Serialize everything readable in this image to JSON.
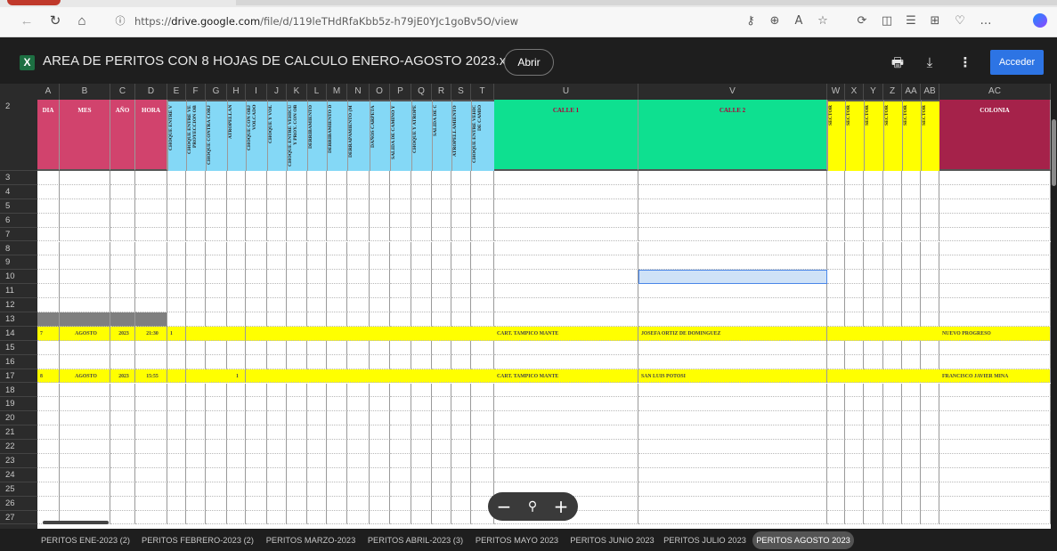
{
  "browser": {
    "url_prefix": "https://",
    "url_domain": "drive.google.com",
    "url_path": "/file/d/119leTHdRfaKbb5z-h79jE0YJc1goBv5O/view"
  },
  "viewer": {
    "file_icon": "X",
    "title": "AREA DE PERITOS CON 8 HOJAS DE CALCULO ENERO-AGOSTO 2023.xlsx",
    "open_label": "Abrir",
    "login_label": "Acceder"
  },
  "spreadsheet": {
    "columns": [
      "A",
      "B",
      "C",
      "D",
      "E",
      "F",
      "G",
      "H",
      "I",
      "J",
      "K",
      "L",
      "M",
      "N",
      "O",
      "P",
      "Q",
      "R",
      "S",
      "T",
      "U",
      "V",
      "W",
      "X",
      "Y",
      "Z",
      "AA",
      "AB",
      "AC"
    ],
    "rows": [
      "2",
      "3",
      "4",
      "5",
      "6",
      "7",
      "8",
      "9",
      "10",
      "11",
      "12",
      "13",
      "14",
      "15",
      "16",
      "17",
      "18",
      "19",
      "20",
      "21",
      "22",
      "23",
      "24",
      "25",
      "26",
      "27"
    ],
    "headers": {
      "A": "DIA",
      "B": "MES",
      "C": "AÑO",
      "D": "HORA",
      "E": "CHOQUE ENTRE V",
      "F": "CHOQUE ENTRE VE PROYECCION OB",
      "G": "CHOQUE CONTRA CORJ",
      "H": "ATROPELLAN",
      "I": "CHOQUE CON OBJ VOLCADO",
      "J": "CHOQUE Y VOL",
      "K": "CHOQUE ENTRE VEHICU Y PROY. CON OB",
      "L": "DERRIBAMIENTO",
      "M": "DERRIBAMIENTO D",
      "N": "DERRAPAMIENTO (M",
      "O": "DAÑOS CARPETA",
      "P": "SALIDA DE CAMINO Y",
      "Q": "CHOQUE Y ATROPE",
      "R": "SALIDA DE C",
      "S": "ATROPELLAMIENTO",
      "T": "CHOQUE ENTRE VEHIC DE CAMIO",
      "U": "CALLE 1",
      "V": "CALLE 2",
      "W": "SECTOR",
      "X": "SECTOR",
      "Y": "SECTOR",
      "Z": "SECTOR",
      "AA": "SECTOR",
      "AB": "SECTOR",
      "AC": "COLONIA"
    },
    "data_rows": [
      {
        "row": "14",
        "dia": "7",
        "mes": "AGOSTO",
        "anio": "2023",
        "hora": "21:30",
        "e": "1",
        "h": "",
        "calle1": "CART. TAMPICO MANTE",
        "calle2": "JOSEFA ORTIZ DE DOMINGUEZ",
        "colonia": "NUEVO PROGRESO"
      },
      {
        "row": "17",
        "dia": "8",
        "mes": "AGOSTO",
        "anio": "2023",
        "hora": "15:55",
        "e": "",
        "h": "1",
        "calle1": "CART. TAMPICO MANTE",
        "calle2": "SAN LUIS POTOSI",
        "colonia": "FRANCISCO JAVIER MINA"
      }
    ],
    "colors": {
      "pink": "#d1436d",
      "blue": "#84d8f6",
      "green": "#0ee090",
      "yellow": "#ffff00",
      "maroon": "#a5224a",
      "selection": "#cfe2f7"
    }
  },
  "zoom": {
    "minus": "−",
    "icon": "⚲",
    "plus": "+"
  },
  "sheet_tabs": [
    {
      "label": "PERITOS ENE-2023 (2)",
      "active": false
    },
    {
      "label": "PERITOS FEBRERO-2023 (2)",
      "active": false
    },
    {
      "label": "PERITOS MARZO-2023",
      "active": false
    },
    {
      "label": "PERITOS ABRIL-2023 (3)",
      "active": false
    },
    {
      "label": "PERITOS MAYO 2023",
      "active": false
    },
    {
      "label": "PERITOS JUNIO 2023",
      "active": false
    },
    {
      "label": "PERITOS JULIO 2023",
      "active": false
    },
    {
      "label": "PERITOS AGOSTO 2023",
      "active": true
    }
  ]
}
